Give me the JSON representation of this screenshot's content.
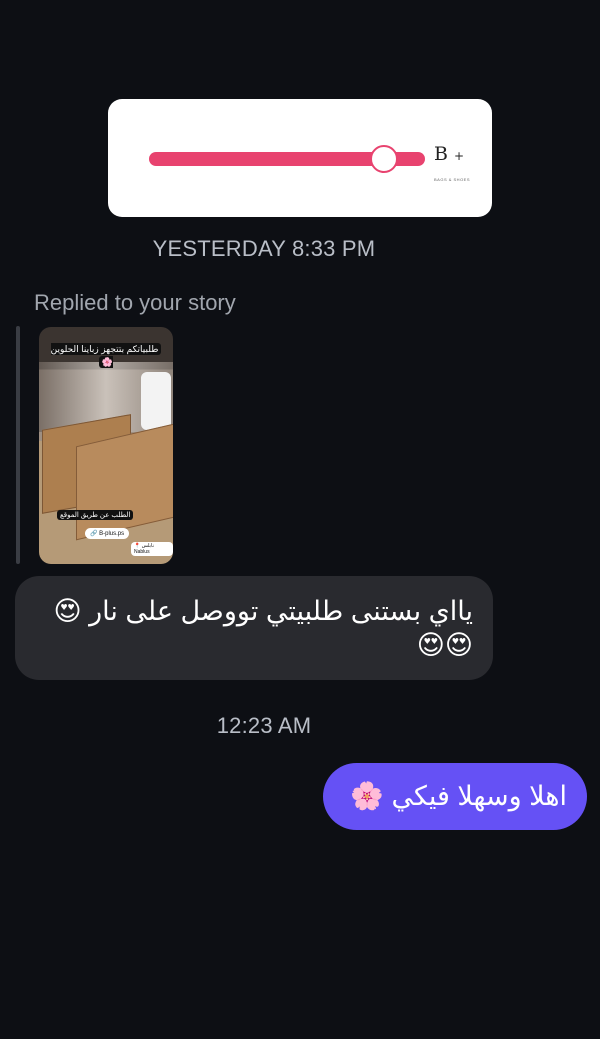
{
  "story_share": {
    "brand": "B",
    "brand_plus": "+",
    "brand_sub": "BAGS & SHOES",
    "progress_percent": 82,
    "accent_color": "#e8436f"
  },
  "timestamps": {
    "first": "YESTERDAY 8:33 PM",
    "second": "12:23 AM"
  },
  "reply_label": "Replied to your story",
  "story_thumbnail": {
    "caption_top": "طلبياتكم بتتجهز زباينا الحلوين 🌸",
    "caption_bottom": "الطلب عن طريق الموقع",
    "site": "🔗 B-plus.ps",
    "location": "📍 نابلس Nablus"
  },
  "messages": {
    "incoming": "يااي بستنى طلبيتي تووصل على نار 😍😍😍",
    "outgoing": "اهلا وسهلا فيكي 🌸"
  },
  "colors": {
    "background": "#0d0f14",
    "incoming_bubble": "#292a2f",
    "outgoing_bubble": "#6551f5"
  }
}
